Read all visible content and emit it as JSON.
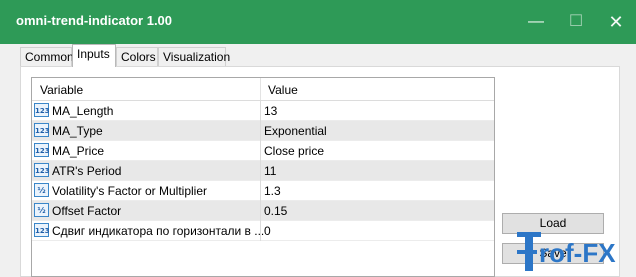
{
  "window": {
    "title": "omni-trend-indicator 1.00",
    "min_icon": "—",
    "max_icon": "☐",
    "close_icon": "✕"
  },
  "tabs": [
    {
      "label": "Common"
    },
    {
      "label": "Inputs"
    },
    {
      "label": "Colors"
    },
    {
      "label": "Visualization"
    }
  ],
  "table": {
    "headers": {
      "variable": "Variable",
      "value": "Value"
    },
    "rows": [
      {
        "icon": "123",
        "variable": "MA_Length",
        "value": "13"
      },
      {
        "icon": "123",
        "variable": "MA_Type",
        "value": "Exponential"
      },
      {
        "icon": "123",
        "variable": "MA_Price",
        "value": "Close price"
      },
      {
        "icon": "123",
        "variable": "ATR's Period",
        "value": "11"
      },
      {
        "icon": "½",
        "variable": "Volatility's Factor or Multiplier",
        "value": "1.3"
      },
      {
        "icon": "½",
        "variable": "Offset Factor",
        "value": "0.15"
      },
      {
        "icon": "123",
        "variable": "Сдвиг индикатора по горизонтали в ...",
        "value": "0"
      }
    ]
  },
  "buttons": {
    "load": "Load",
    "save": "Save"
  },
  "watermark": {
    "text": "rof-FX"
  },
  "colors": {
    "titlebar": "#2e9a57",
    "icon_border": "#3a86c8",
    "watermark": "#2c76c7"
  }
}
